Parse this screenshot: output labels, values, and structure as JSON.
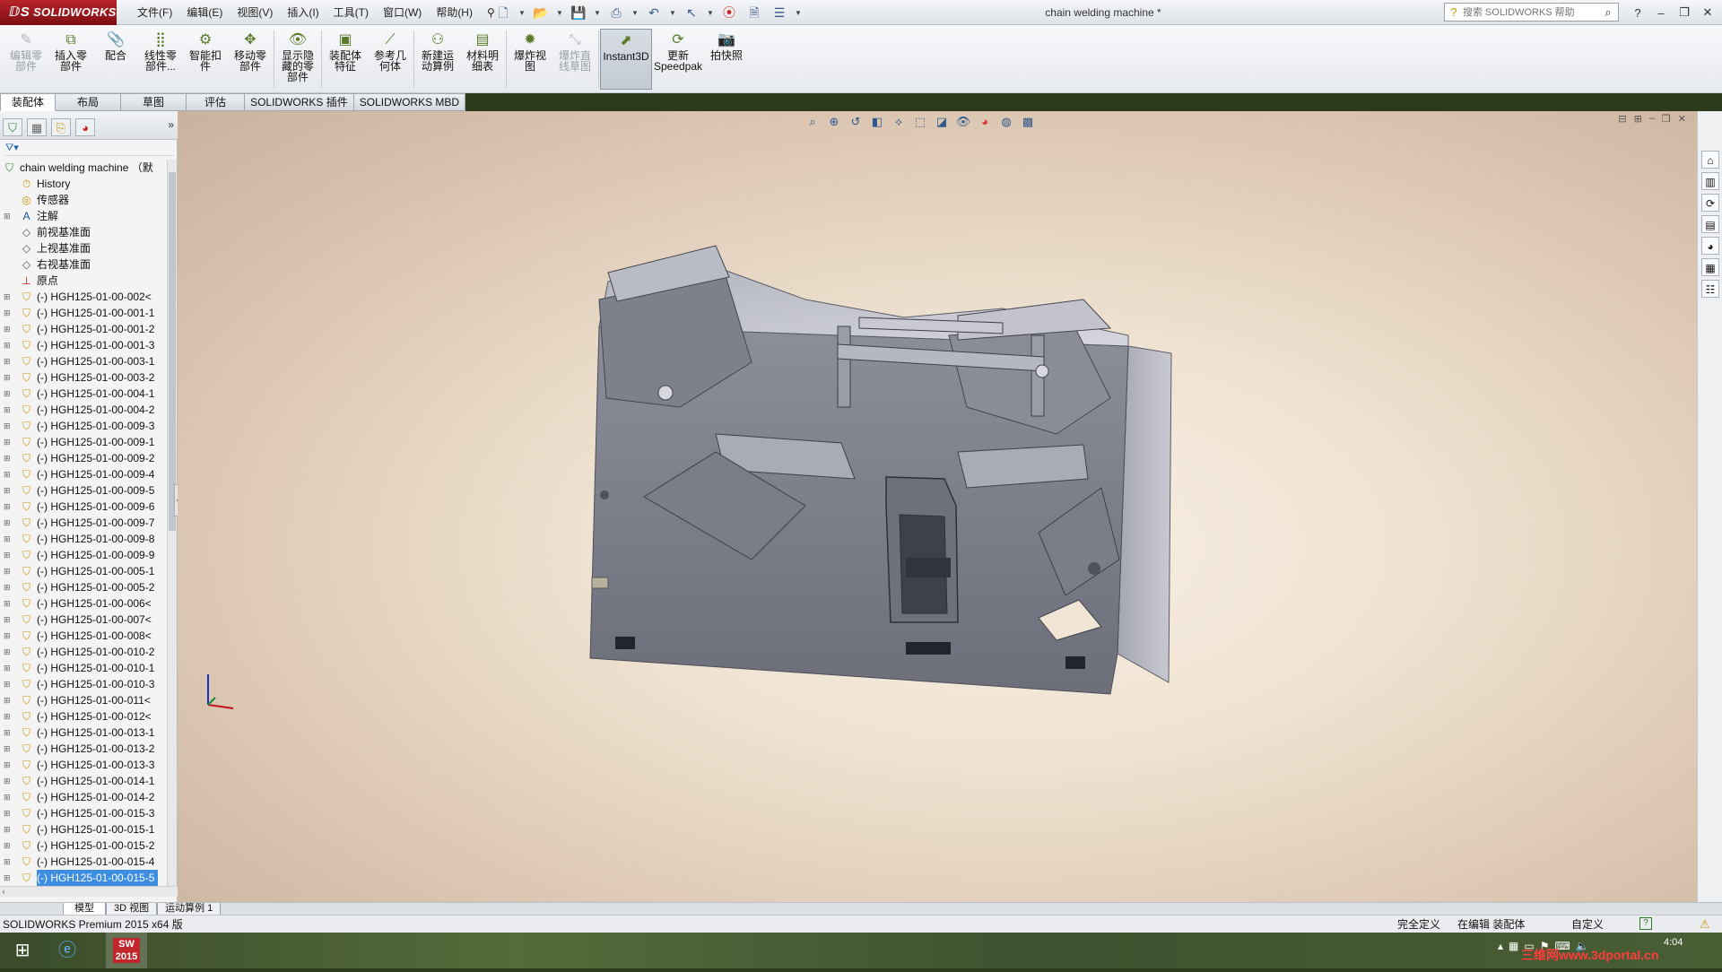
{
  "app": {
    "logo": "SOLIDWORKS",
    "document_title": "chain welding machine *"
  },
  "menus": [
    "文件(F)",
    "编辑(E)",
    "视图(V)",
    "插入(I)",
    "工具(T)",
    "窗口(W)",
    "帮助(H)"
  ],
  "search": {
    "placeholder": "搜索 SOLIDWORKS 帮助"
  },
  "toolbar": {
    "tools": [
      {
        "label": "编辑零\n部件",
        "icon": "edit-component-icon",
        "enabled": false
      },
      {
        "label": "插入零\n部件",
        "icon": "insert-component-icon",
        "enabled": true
      },
      {
        "label": "配合",
        "icon": "mate-icon",
        "enabled": true
      },
      {
        "label": "线性零\n部件...",
        "icon": "linear-pattern-icon",
        "enabled": true
      },
      {
        "label": "智能扣\n件",
        "icon": "smart-fasteners-icon",
        "enabled": true
      },
      {
        "label": "移动零\n部件",
        "icon": "move-component-icon",
        "enabled": true
      },
      {
        "label": "显示隐\n藏的零\n部件",
        "icon": "show-hidden-icon",
        "enabled": true
      },
      {
        "label": "装配体\n特征",
        "icon": "assembly-features-icon",
        "enabled": true
      },
      {
        "label": "参考几\n何体",
        "icon": "reference-geometry-icon",
        "enabled": true
      },
      {
        "label": "新建运\n动算例",
        "icon": "new-motion-study-icon",
        "enabled": true
      },
      {
        "label": "材料明\n细表",
        "icon": "bom-icon",
        "enabled": true
      },
      {
        "label": "爆炸视\n图",
        "icon": "exploded-view-icon",
        "enabled": true
      },
      {
        "label": "爆炸直\n线草图",
        "icon": "explode-line-sketch-icon",
        "enabled": false
      },
      {
        "label": "Instant3D",
        "icon": "instant3d-icon",
        "enabled": true,
        "active": true
      },
      {
        "label": "更新\nSpeedpak",
        "icon": "speedpak-icon",
        "enabled": true
      },
      {
        "label": "拍快照",
        "icon": "snapshot-icon",
        "enabled": true
      }
    ]
  },
  "tabs": [
    {
      "label": "装配体",
      "active": true
    },
    {
      "label": "布局",
      "active": false
    },
    {
      "label": "草图",
      "active": false
    },
    {
      "label": "评估",
      "active": false
    },
    {
      "label": "SOLIDWORKS 插件",
      "active": false
    },
    {
      "label": "SOLIDWORKS MBD",
      "active": false
    }
  ],
  "tree": {
    "root": "chain welding machine （默",
    "fixed_items": [
      {
        "label": "History",
        "icon": "history-icon"
      },
      {
        "label": "传感器",
        "icon": "sensor-icon"
      },
      {
        "label": "注解",
        "icon": "annotation-icon",
        "expandable": true
      },
      {
        "label": "前视基准面",
        "icon": "plane-icon"
      },
      {
        "label": "上视基准面",
        "icon": "plane-icon"
      },
      {
        "label": "右视基准面",
        "icon": "plane-icon"
      },
      {
        "label": "原点",
        "icon": "origin-icon"
      }
    ],
    "parts": [
      "(-) HGH125-01-00-002<",
      "(-) HGH125-01-00-001-1",
      "(-) HGH125-01-00-001-2",
      "(-) HGH125-01-00-001-3",
      "(-) HGH125-01-00-003-1",
      "(-) HGH125-01-00-003-2",
      "(-) HGH125-01-00-004-1",
      "(-) HGH125-01-00-004-2",
      "(-) HGH125-01-00-009-3",
      "(-) HGH125-01-00-009-1",
      "(-) HGH125-01-00-009-2",
      "(-) HGH125-01-00-009-4",
      "(-) HGH125-01-00-009-5",
      "(-) HGH125-01-00-009-6",
      "(-) HGH125-01-00-009-7",
      "(-) HGH125-01-00-009-8",
      "(-) HGH125-01-00-009-9",
      "(-) HGH125-01-00-005-1",
      "(-) HGH125-01-00-005-2",
      "(-) HGH125-01-00-006<",
      "(-) HGH125-01-00-007<",
      "(-) HGH125-01-00-008<",
      "(-) HGH125-01-00-010-2",
      "(-) HGH125-01-00-010-1",
      "(-) HGH125-01-00-010-3",
      "(-) HGH125-01-00-011<",
      "(-) HGH125-01-00-012<",
      "(-) HGH125-01-00-013-1",
      "(-) HGH125-01-00-013-2",
      "(-) HGH125-01-00-013-3",
      "(-) HGH125-01-00-014-1",
      "(-) HGH125-01-00-014-2",
      "(-) HGH125-01-00-015-3",
      "(-) HGH125-01-00-015-1",
      "(-) HGH125-01-00-015-2",
      "(-) HGH125-01-00-015-4",
      "(-) HGH125-01-00-015-5"
    ],
    "selected_index": 36
  },
  "model_tabs": [
    {
      "label": "模型",
      "active": true
    },
    {
      "label": "3D 视图",
      "active": false
    },
    {
      "label": "运动算例 1",
      "active": false
    }
  ],
  "status": {
    "product": "SOLIDWORKS Premium 2015 x64 版",
    "definition": "完全定义",
    "mode": "在编辑 装配体",
    "units": "自定义"
  },
  "taskbar": {
    "clock": "4:04",
    "sw_badge": "SW\n2015",
    "watermark": "三维网www.3dportal.cn"
  }
}
